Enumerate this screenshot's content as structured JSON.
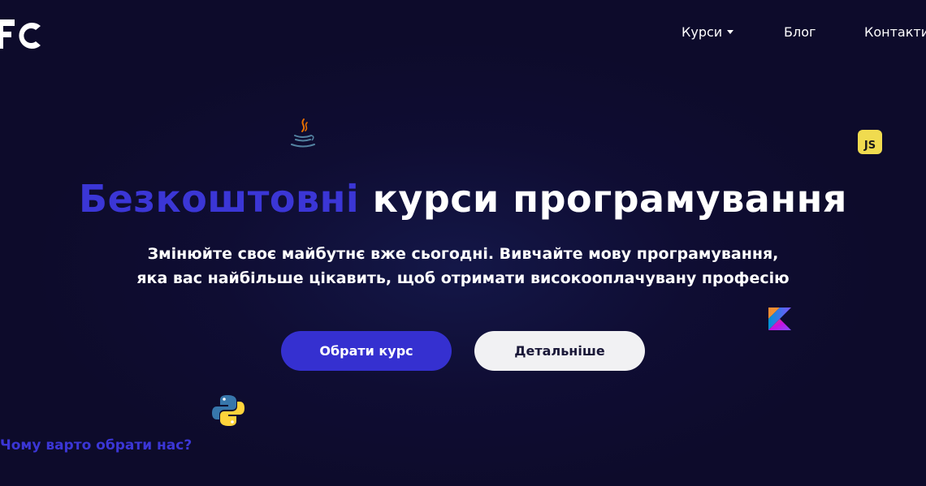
{
  "brand": {
    "logo_text": "FC"
  },
  "nav": {
    "courses_label": "Курси",
    "blog_label": "Блог",
    "contacts_label": "Контакти"
  },
  "decorations": {
    "js_badge": "JS",
    "icons": [
      "java-icon",
      "javascript-icon",
      "kotlin-icon",
      "python-icon"
    ]
  },
  "hero": {
    "title_accent": "Безкоштовні",
    "title_rest": "курси програмування",
    "subtitle_line1": "Змінюйте своє майбутнє вже сьогодні. Вивчайте мову програмування,",
    "subtitle_line2": "яка вас найбільше цікавить, щоб отримати високооплачувану професію",
    "primary_button": "Обрати курс",
    "secondary_button": "Детальніше"
  },
  "why_link": "Чому варто обрати нас?",
  "colors": {
    "background": "#0d0b2b",
    "accent": "#3530d0",
    "text": "#ffffff",
    "secondary_button_bg": "#f1f1f3"
  }
}
